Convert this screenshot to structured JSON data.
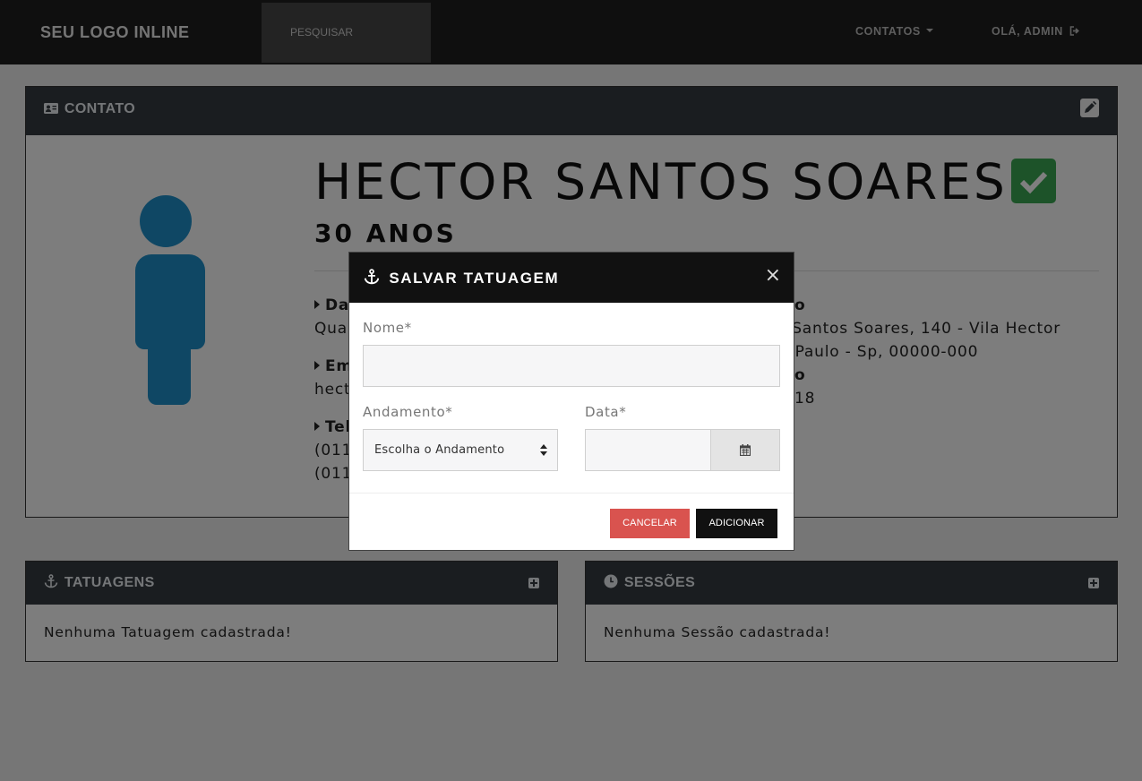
{
  "navbar": {
    "brand": "SEU LOGO INLINE",
    "search_placeholder": "PESQUISAR",
    "contacts_menu": "CONTATOS",
    "user_greeting": "OLÁ, ADMIN"
  },
  "contact_card": {
    "title": "CONTATO",
    "name": "HECTOR SANTOS SOARES",
    "age": "30 ANOS",
    "left_items": [
      {
        "label": "Da",
        "value": "Quar"
      },
      {
        "label": "Em",
        "value": "hect"
      },
      {
        "label": "Tel",
        "value_1": "(011",
        "value_2": "(011"
      }
    ],
    "right_items": {
      "label_tail": "o",
      "address_1": "or Santos Soares, 140 - Vila Hector",
      "address_2": "ão Paulo - Sp, 00000-000",
      "label2_tail": "o",
      "value2_tail": "18"
    }
  },
  "tattoos_card": {
    "title": "TATUAGENS",
    "empty_message": "Nenhuma Tatuagem cadastrada!"
  },
  "sessions_card": {
    "title": "SESSÕES",
    "empty_message": "Nenhuma Sessão cadastrada!"
  },
  "modal": {
    "title": "SALVAR TATUAGEM",
    "close": "×",
    "name_label": "Nome*",
    "name_value": "",
    "progress_label": "Andamento*",
    "progress_selected": "Escolha o Andamento",
    "date_label": "Data*",
    "date_value": "",
    "cancel_label": "CANCELAR",
    "add_label": "ADICIONAR"
  },
  "colors": {
    "navbar_bg": "#1f1f1f",
    "card_header_bg": "#343a40",
    "avatar": "#1f8fc9",
    "verified": "#3ba753",
    "cancel": "#d9534f",
    "add": "#111111"
  },
  "icons": [
    "logout-icon",
    "id-card-icon",
    "edit-icon",
    "user-icon",
    "check-icon",
    "anchor-icon",
    "clock-icon",
    "plus-square-icon",
    "calendar-icon",
    "close-icon",
    "caret-right-icon"
  ]
}
